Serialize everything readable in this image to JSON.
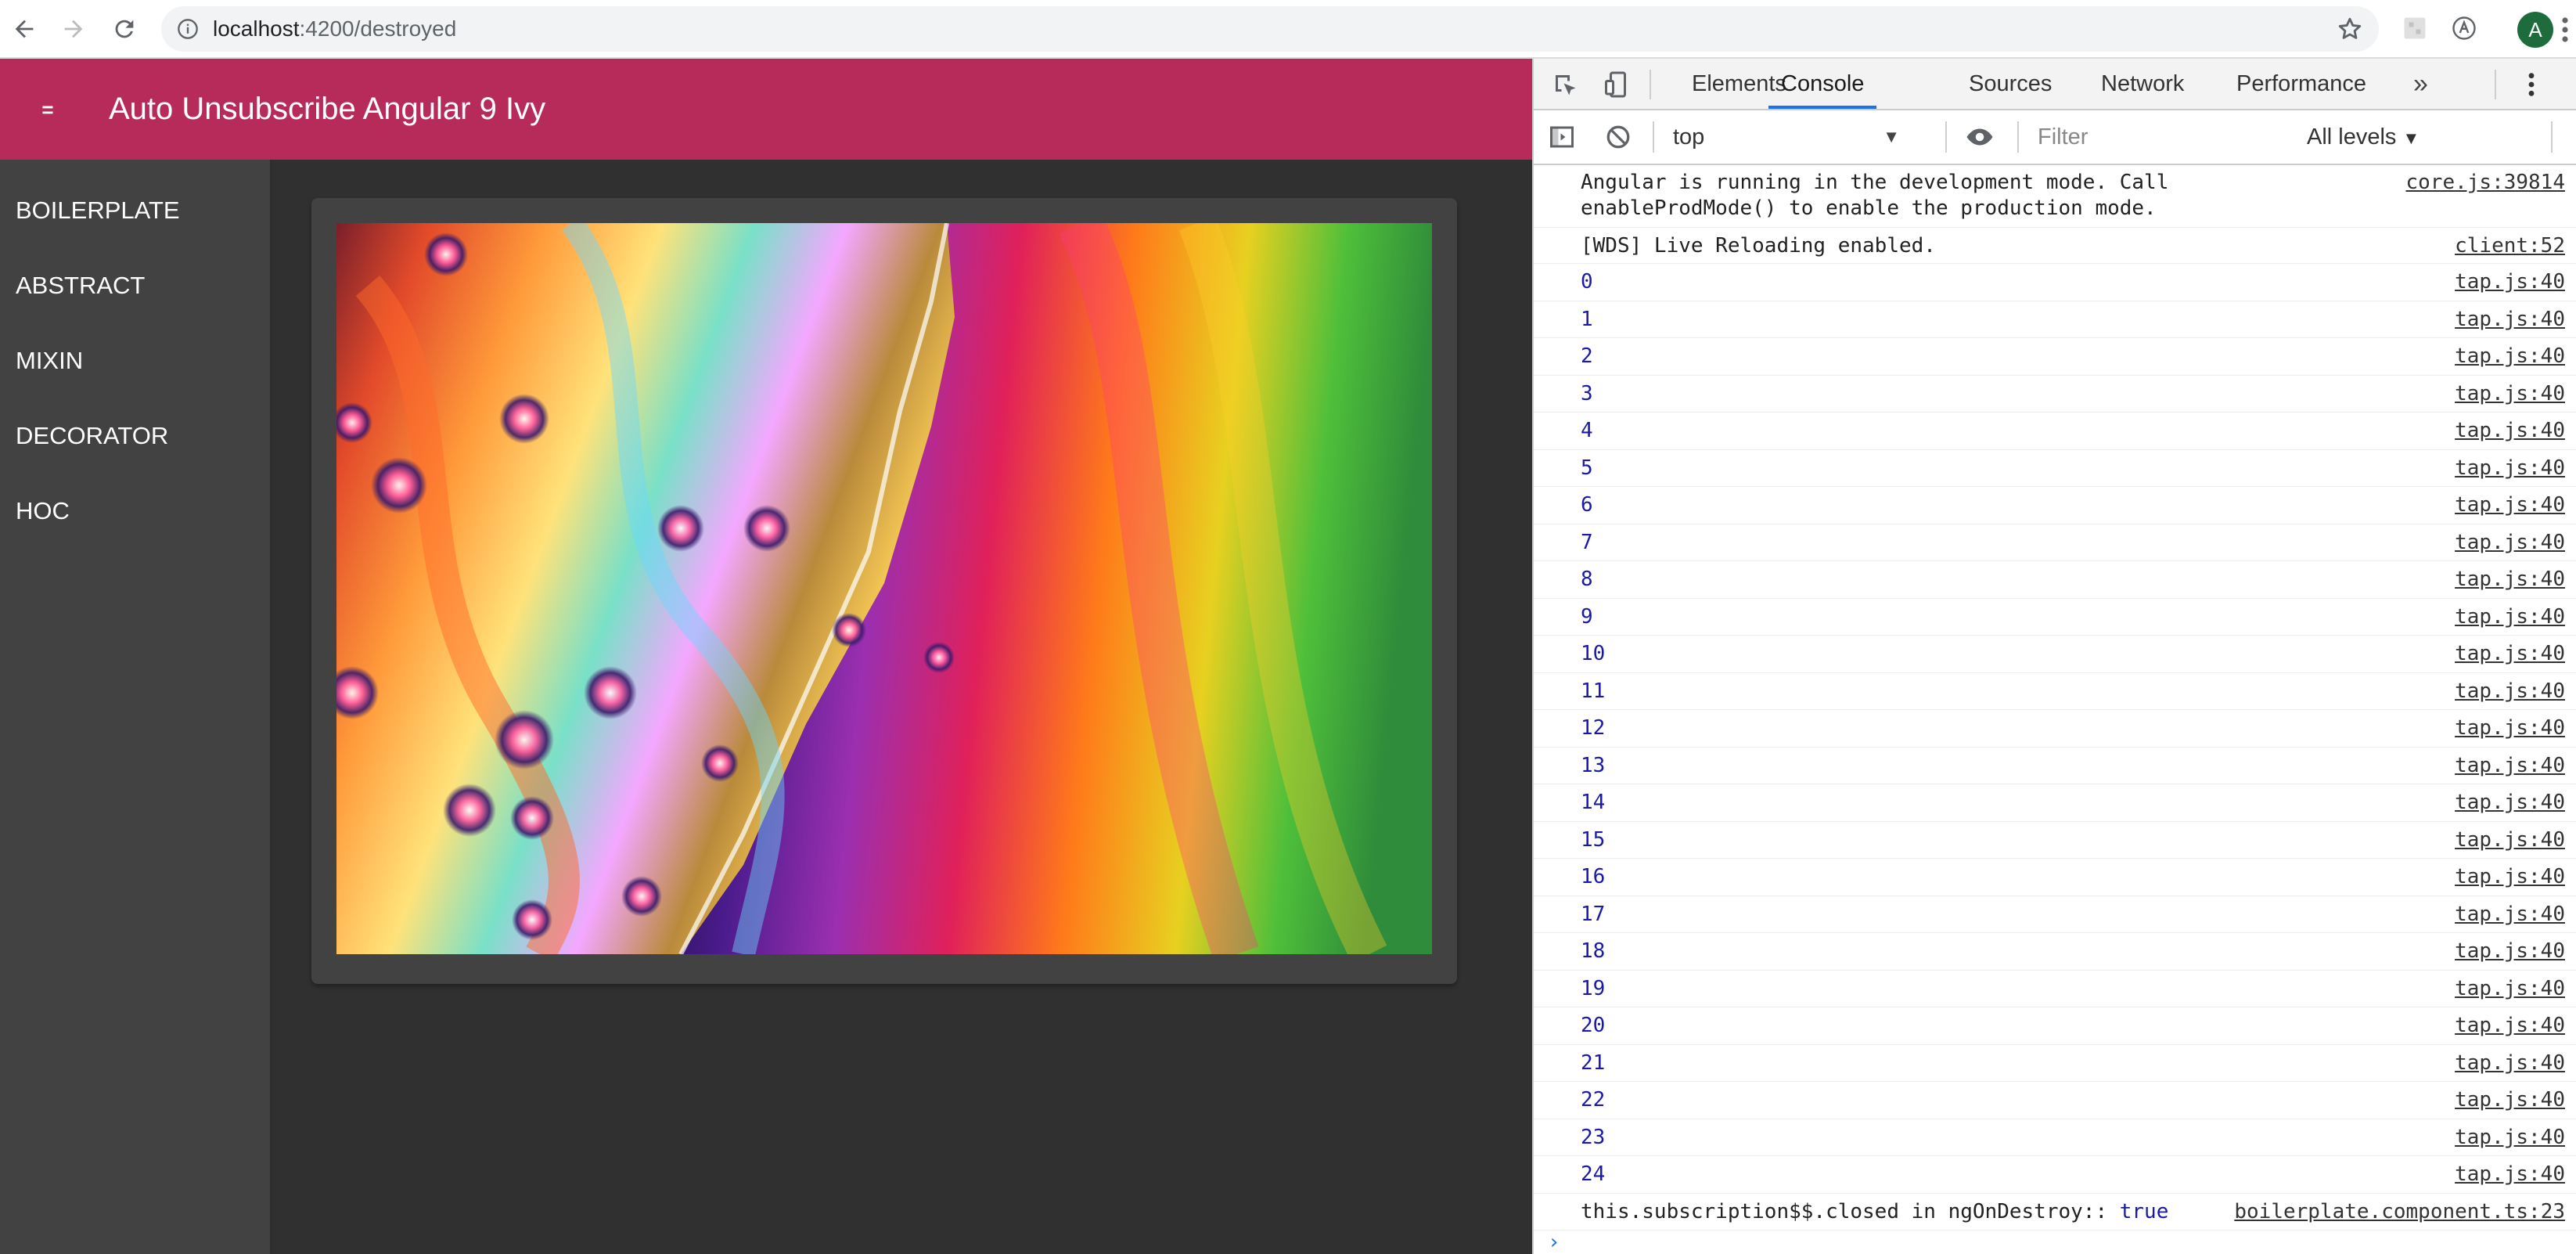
{
  "browser": {
    "url_host": "localhost",
    "url_path": ":4200/destroyed",
    "avatar_letter": "A"
  },
  "app": {
    "menu_icon": "=",
    "title": "Auto Unsubscribe Angular 9 Ivy",
    "toolbar_color": "#b72b5b",
    "nav": [
      "BOILERPLATE",
      "ABSTRACT",
      "MIXIN",
      "DECORATOR",
      "HOC"
    ]
  },
  "devtools": {
    "tabs": [
      "Elements",
      "Console",
      "Sources",
      "Network",
      "Performance"
    ],
    "active_tab": "Console",
    "context": "top",
    "filter_placeholder": "Filter",
    "levels": "All levels",
    "logs": [
      {
        "msg": "Angular is running in the development mode. Call\nenableProdMode() to enable the production mode.",
        "src": "core.js:39814",
        "kind": "two"
      },
      {
        "msg": "[WDS] Live Reloading enabled.",
        "src": "client:52",
        "kind": "text"
      },
      {
        "msg": "0",
        "src": "tap.js:40",
        "kind": "num"
      },
      {
        "msg": "1",
        "src": "tap.js:40",
        "kind": "num"
      },
      {
        "msg": "2",
        "src": "tap.js:40",
        "kind": "num"
      },
      {
        "msg": "3",
        "src": "tap.js:40",
        "kind": "num"
      },
      {
        "msg": "4",
        "src": "tap.js:40",
        "kind": "num"
      },
      {
        "msg": "5",
        "src": "tap.js:40",
        "kind": "num"
      },
      {
        "msg": "6",
        "src": "tap.js:40",
        "kind": "num"
      },
      {
        "msg": "7",
        "src": "tap.js:40",
        "kind": "num"
      },
      {
        "msg": "8",
        "src": "tap.js:40",
        "kind": "num"
      },
      {
        "msg": "9",
        "src": "tap.js:40",
        "kind": "num"
      },
      {
        "msg": "10",
        "src": "tap.js:40",
        "kind": "num"
      },
      {
        "msg": "11",
        "src": "tap.js:40",
        "kind": "num"
      },
      {
        "msg": "12",
        "src": "tap.js:40",
        "kind": "num"
      },
      {
        "msg": "13",
        "src": "tap.js:40",
        "kind": "num"
      },
      {
        "msg": "14",
        "src": "tap.js:40",
        "kind": "num"
      },
      {
        "msg": "15",
        "src": "tap.js:40",
        "kind": "num"
      },
      {
        "msg": "16",
        "src": "tap.js:40",
        "kind": "num"
      },
      {
        "msg": "17",
        "src": "tap.js:40",
        "kind": "num"
      },
      {
        "msg": "18",
        "src": "tap.js:40",
        "kind": "num"
      },
      {
        "msg": "19",
        "src": "tap.js:40",
        "kind": "num"
      },
      {
        "msg": "20",
        "src": "tap.js:40",
        "kind": "num"
      },
      {
        "msg": "21",
        "src": "tap.js:40",
        "kind": "num"
      },
      {
        "msg": "22",
        "src": "tap.js:40",
        "kind": "num"
      },
      {
        "msg": "23",
        "src": "tap.js:40",
        "kind": "num"
      },
      {
        "msg": "24",
        "src": "tap.js:40",
        "kind": "num"
      }
    ],
    "last_log": {
      "prefix": "this.subscription$$.closed in ngOnDestroy:: ",
      "value": "true",
      "src": "boilerplate.component.ts:23"
    },
    "prompt": "›"
  }
}
